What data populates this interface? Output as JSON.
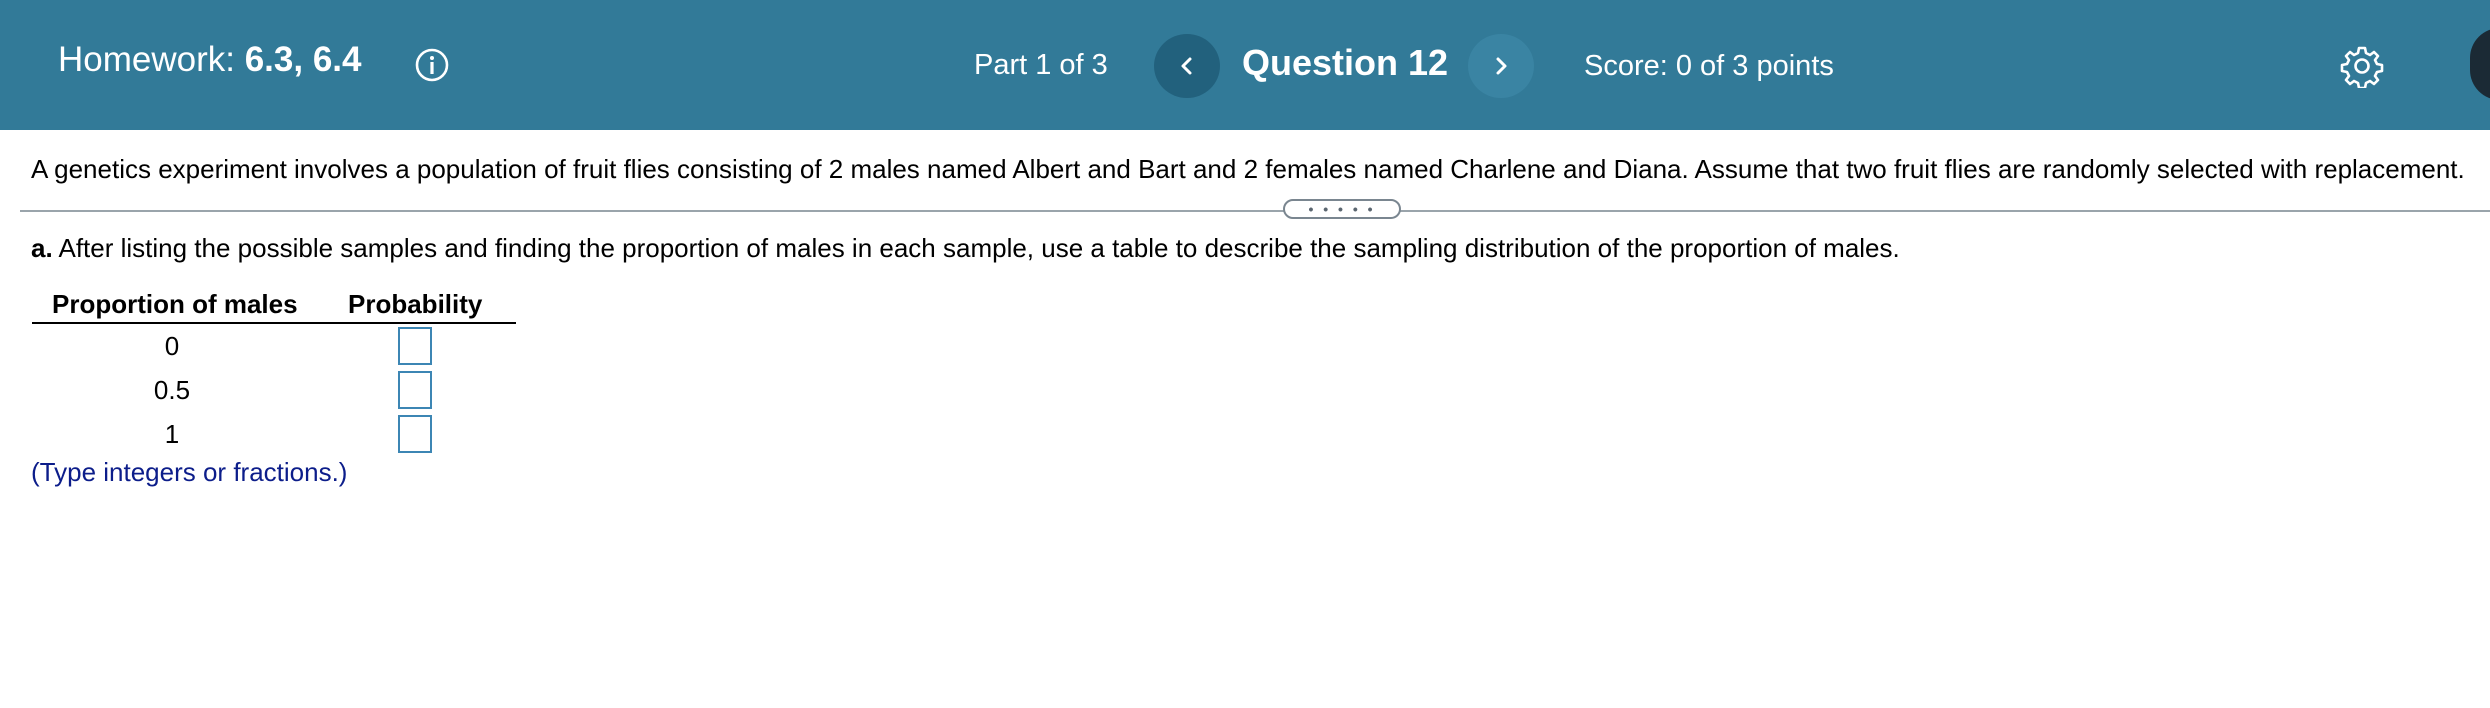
{
  "header": {
    "homework_prefix": "Homework:",
    "homework_sections": "6.3, 6.4",
    "part": "Part 1 of 3",
    "question": "Question 12",
    "score": "Score: 0 of 3 points",
    "background_color": "#327a98"
  },
  "icons": {
    "info": "info-icon",
    "prev": "chevron-left-icon",
    "next": "chevron-right-icon",
    "settings": "gear-icon"
  },
  "question": {
    "stem": "A genetics experiment involves a population of fruit flies consisting of 2 males named Albert and Bart and 2 females named Charlene and Diana. Assume that two fruit flies are randomly selected with replacement.",
    "expander_label": "• • • • •",
    "part_a_letter": "a.",
    "part_a_text": " After listing the possible samples and finding the proportion of males in each sample, use a table to describe the sampling distribution of the proportion of males.",
    "table": {
      "headers": [
        "Proportion of males",
        "Probability"
      ],
      "rows": [
        {
          "proportion": "0",
          "probability": ""
        },
        {
          "proportion": "0.5",
          "probability": ""
        },
        {
          "proportion": "1",
          "probability": ""
        }
      ]
    },
    "hint": "(Type integers or fractions.)",
    "accent_color": "#3c86b4",
    "hint_color": "#0c1d8a"
  }
}
